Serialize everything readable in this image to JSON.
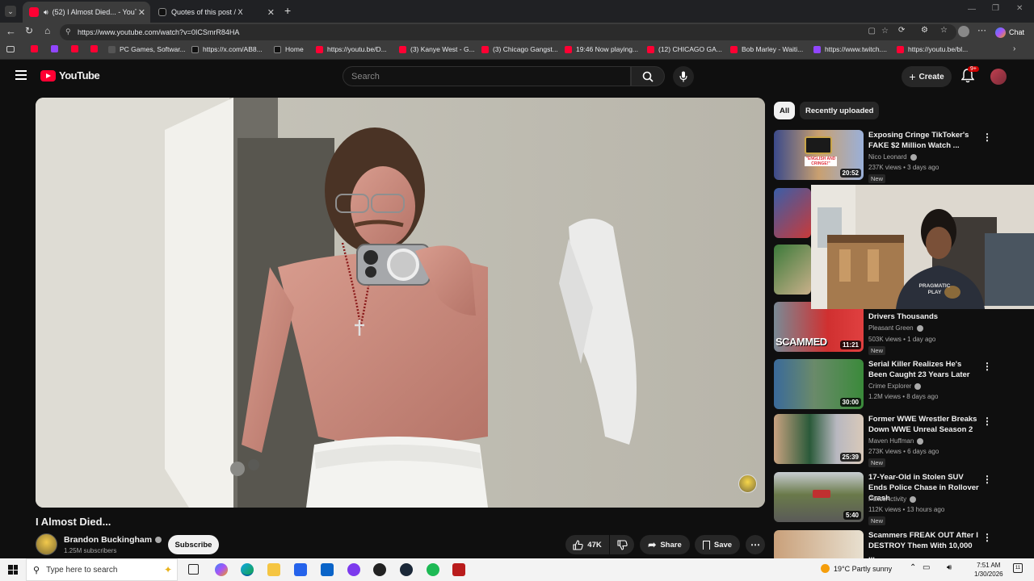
{
  "browser": {
    "tabs": [
      {
        "label": "(52) I Almost Died... - YouTube",
        "active": true
      },
      {
        "label": "Quotes of this post / X",
        "active": false
      }
    ],
    "url": "https://www.youtube.com/watch?v=0ICSmrR84HA",
    "chat_label": "Chat",
    "bookmarks": [
      {
        "label": "",
        "icon": "youtube-icon"
      },
      {
        "label": "",
        "icon": "twitch-icon"
      },
      {
        "label": "",
        "icon": "youtube-icon"
      },
      {
        "label": "",
        "icon": "youtube-icon"
      },
      {
        "label": "PC Games, Softwar...",
        "icon": "pc-icon"
      },
      {
        "label": "https://x.com/AB8...",
        "icon": "x-icon"
      },
      {
        "label": "Home",
        "icon": "x-icon"
      },
      {
        "label": "https://youtu.be/D...",
        "icon": "youtube-icon"
      },
      {
        "label": "(3) Kanye West - G...",
        "icon": "youtube-icon"
      },
      {
        "label": "(3) Chicago Gangst...",
        "icon": "youtube-icon"
      },
      {
        "label": "19:46 Now playing...",
        "icon": "youtube-icon"
      },
      {
        "label": "(12) CHICAGO GA...",
        "icon": "youtube-icon"
      },
      {
        "label": "Bob Marley - Waiti...",
        "icon": "youtube-icon"
      },
      {
        "label": "https://www.twitch....",
        "icon": "twitch-icon"
      },
      {
        "label": "https://youtu.be/bl...",
        "icon": "youtube-icon"
      }
    ]
  },
  "youtube": {
    "logo": "YouTube",
    "search_placeholder": "Search",
    "create_label": "Create",
    "notification_count": "9+",
    "chips": [
      "All",
      "Recently uploaded"
    ],
    "video": {
      "title": "I Almost Died...",
      "channel": "Brandon Buckingham",
      "subscribers": "1.25M subscribers",
      "subscribe_label": "Subscribe",
      "likes": "47K",
      "share_label": "Share",
      "save_label": "Save"
    },
    "recommended": [
      {
        "title": "Exposing Cringe TikToker's FAKE $2 Million Watch ...",
        "channel": "Nico Leonard",
        "meta": "237K views • 3 days ago",
        "duration": "20:52",
        "new": "New"
      },
      {
        "title": "Drivers Thousands",
        "channel": "Pleasant Green",
        "meta": "503K views • 1 day ago",
        "duration": "11:21",
        "new": "New"
      },
      {
        "title": "Serial Killer Realizes He's Been Caught 23 Years Later",
        "channel": "Crime Explorer",
        "meta": "1.2M views • 8 days ago",
        "duration": "30:00",
        "new": ""
      },
      {
        "title": "Former WWE Wrestler Breaks Down WWE Unreal Season 2",
        "channel": "Maven Huffman",
        "meta": "273K views • 6 days ago",
        "duration": "25:39",
        "new": "New"
      },
      {
        "title": "17-Year-Old in Stolen SUV Ends Police Chase in Rollover Crash",
        "channel": "PoliceActivity",
        "meta": "112K views • 13 hours ago",
        "duration": "5:40",
        "new": "New"
      },
      {
        "title": "Scammers FREAK OUT After I DESTROY Them With 10,000 ...",
        "channel": "",
        "meta": "",
        "duration": "",
        "new": ""
      }
    ],
    "thumb_text_scammed": "SCAMMED",
    "thumb_text_cringe": "\"ENGLISH AND CRINGE!\""
  },
  "webcam": {
    "shirt_text": "PRAGMATIC PLAY"
  },
  "taskbar": {
    "search_placeholder": "Type here to search",
    "weather": "19°C  Partly sunny",
    "time": "7:51 AM",
    "date": "1/30/2026",
    "notif_count": "11"
  },
  "colors": {
    "youtube_red": "#ff0033",
    "bg": "#0f0f0f",
    "chip_active": "#f1f1f1",
    "taskbar": "#f3f3f3"
  }
}
